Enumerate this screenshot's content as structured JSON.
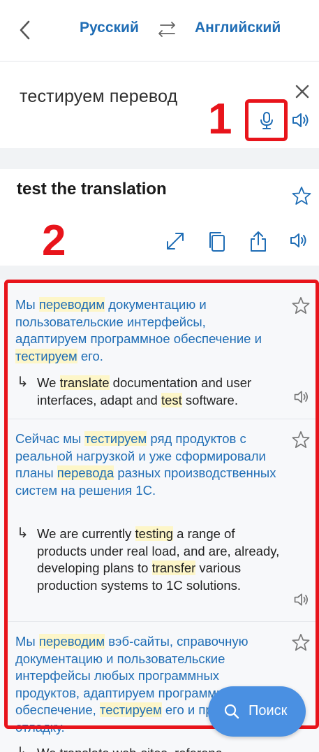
{
  "header": {
    "source_lang": "Русский",
    "target_lang": "Английский"
  },
  "input": {
    "text": "тестируем перевод"
  },
  "annotations": {
    "marker_1": "1",
    "marker_2": "2"
  },
  "result": {
    "text": "test the translation"
  },
  "examples": [
    {
      "src_parts": [
        "Мы ",
        "переводим",
        " документацию и пользовательские интерфейсы, адаптируем программное обеспечение и ",
        "тестируем",
        " его."
      ],
      "tr_parts": [
        "We ",
        "translate",
        " documentation and user interfaces, adapt and ",
        "test",
        " software."
      ]
    },
    {
      "src_parts": [
        "Сейчас мы ",
        "тестируем",
        " ряд продуктов с реальной нагрузкой и уже сформировали планы ",
        "перевода",
        " разных производственных систем на решения 1С."
      ],
      "tr_parts": [
        "We are currently ",
        "testing",
        " a range of products under real load, and are, already, developing plans to ",
        "transfer",
        " various production systems to 1C solutions."
      ]
    },
    {
      "src_parts": [
        "Мы ",
        "переводим",
        " вэб-сайты, справочную документацию и пользовательские интерфейсы любых программных продуктов, адаптируем программное обеспечение, ",
        "тестируем",
        " его и проводим отладку."
      ],
      "tr_parts": [
        "We translate web-sites, referenc"
      ]
    }
  ],
  "search_button": {
    "label": "Поиск"
  },
  "colors": {
    "accent": "#1f6db5",
    "annotation": "#e8141b",
    "fab": "#4a90e2",
    "highlight": "#fdf6c8"
  }
}
